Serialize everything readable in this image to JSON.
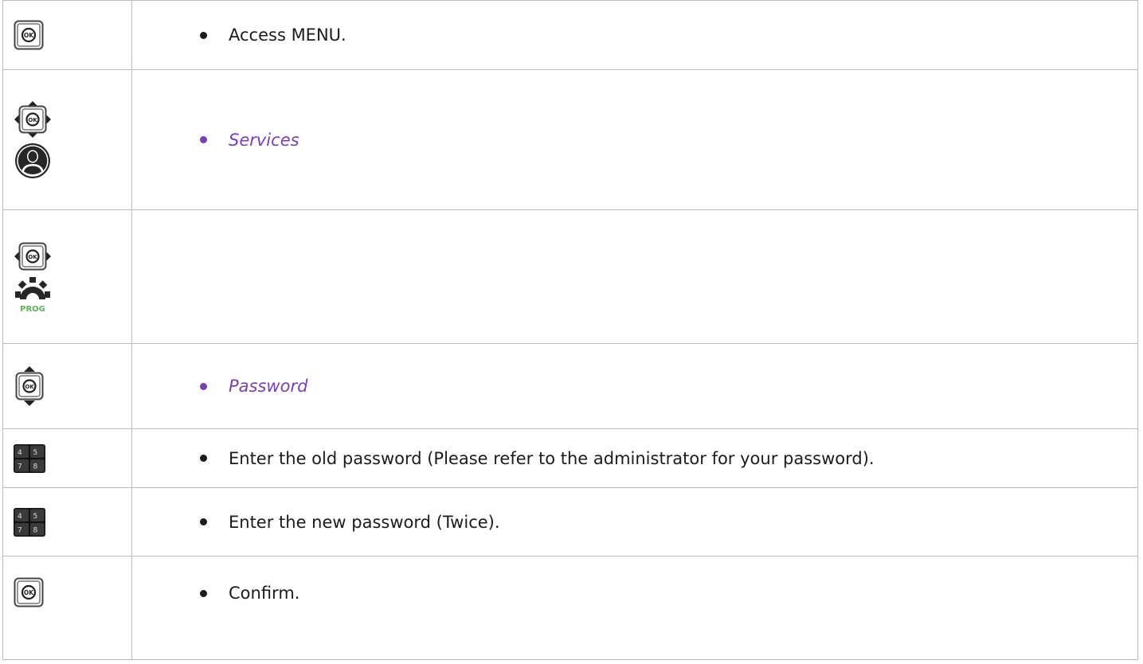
{
  "steps": [
    {
      "icons": [
        "ok-key-icon"
      ],
      "text": "Access MENU.",
      "style": "plain"
    },
    {
      "icons": [
        "navigator-4way-icon",
        "user-profile-icon"
      ],
      "text": "Services",
      "style": "menu-item"
    },
    {
      "icons": [
        "navigator-left-right-icon",
        "prog-gear-icon"
      ],
      "text": "",
      "style": "none"
    },
    {
      "icons": [
        "navigator-up-down-icon"
      ],
      "text": "Password",
      "style": "menu-item"
    },
    {
      "icons": [
        "keypad-icon"
      ],
      "text": "Enter the old password (Please refer to the administrator for your password).",
      "style": "plain"
    },
    {
      "icons": [
        "keypad-icon"
      ],
      "text": "Enter the new password (Twice).",
      "style": "plain"
    },
    {
      "icons": [
        "ok-key-icon"
      ],
      "text": "Confirm.",
      "style": "plain"
    }
  ],
  "icon_labels": {
    "ok": "OK",
    "prog": "PROG",
    "keypad": [
      "4",
      "5",
      "7",
      "8"
    ]
  },
  "colors": {
    "menu_item_text": "#7a3fb0",
    "prog_label": "#5cb85c",
    "border": "#bdbdbd"
  }
}
